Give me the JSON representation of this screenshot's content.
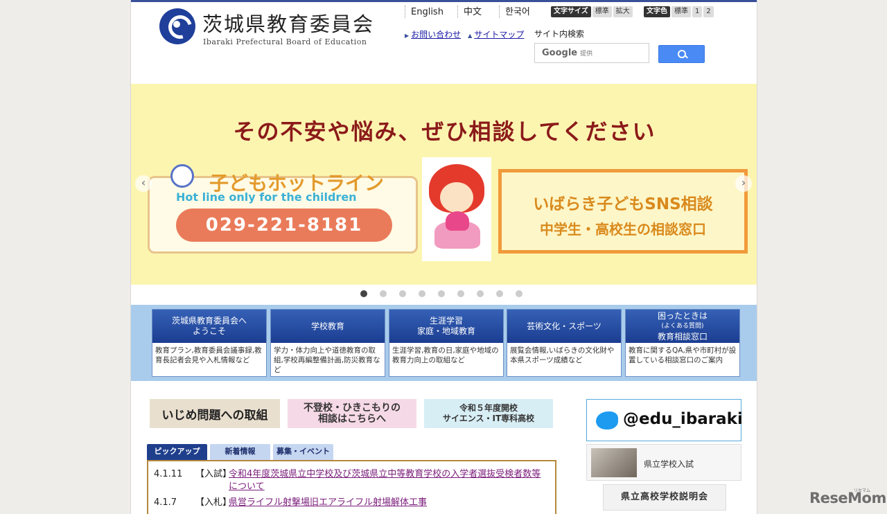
{
  "header": {
    "org_name_jp": "茨城県教育委員会",
    "org_name_en": "Ibaraki Prefectural Board of Education",
    "languages": [
      "English",
      "中文",
      "한국어"
    ],
    "font_size": {
      "label": "文字サイズ",
      "options": [
        "標準",
        "拡大"
      ]
    },
    "font_color": {
      "label": "文字色",
      "options": [
        "標準",
        "1",
        "2"
      ]
    },
    "links": [
      {
        "label": "お問い合わせ"
      },
      {
        "label": "サイトマップ"
      }
    ],
    "search": {
      "label": "サイト内検索",
      "placeholder_brand": "Google",
      "placeholder_suffix": "提供"
    }
  },
  "banner": {
    "headline": "その不安や悩み、ぜひ相談してください",
    "hotline_title": "子どもホットライン",
    "hotline_en": "Hot line only for the children",
    "hotline_number": "029-221-8181",
    "sns_title": "いばらき子どもSNS相談",
    "sns_sub": "中学生・高校生の相談窓口",
    "slides_total": 9,
    "slide_active": 1
  },
  "nav": [
    {
      "title_line1": "茨城県教育委員会へ",
      "title_line2": "ようこそ",
      "desc": "教育プラン,教育委員会議事録,教育長記者会見や入札情報など"
    },
    {
      "title_line1": "学校教育",
      "title_line2": "",
      "desc": "学力・体力向上や道徳教育の取組,学校再編整備計画,防災教育など"
    },
    {
      "title_line1": "生涯学習",
      "title_line2": "家庭・地域教育",
      "desc": "生涯学習,教育の日,家庭や地域の教育力向上の取組など"
    },
    {
      "title_line1": "芸術文化・スポーツ",
      "title_line2": "",
      "desc": "展覧会情報,いばらきの文化財や本県スポーツ成績など"
    },
    {
      "title_line1": "困ったときは",
      "title_small": "(よくある質問)",
      "title_line2": "教育相談窓口",
      "desc": "教育に関するQA,県や市町村が設置している相談窓口のご案内"
    }
  ],
  "small_banners": [
    {
      "line1": "いじめ問題への取組",
      "line2": ""
    },
    {
      "line1": "不登校・ひきこもりの",
      "line2": "相談はこちらへ"
    },
    {
      "line1": "令和５年度開校",
      "line2": "サイエンス・IT専科高校"
    }
  ],
  "tabs": [
    "ピックアップ",
    "新着情報",
    "募集・イベント"
  ],
  "news": [
    {
      "date": "4.1.11",
      "cat": "【入試】",
      "title": "令和4年度茨城県立中学校及び茨城県立中等教育学校の入学者選抜受検者数等について"
    },
    {
      "date": "4.1.7",
      "cat": "【入札】",
      "title": "県営ライフル射撃場旧エアライフル射場解体工事"
    }
  ],
  "sidebar": {
    "twitter_handle": "@edu_ibaraki",
    "school_link": "県立学校入試",
    "explain_link": "県立高校学校説明会"
  },
  "watermark": {
    "main": "ReseMom",
    "small": "リセマム"
  }
}
